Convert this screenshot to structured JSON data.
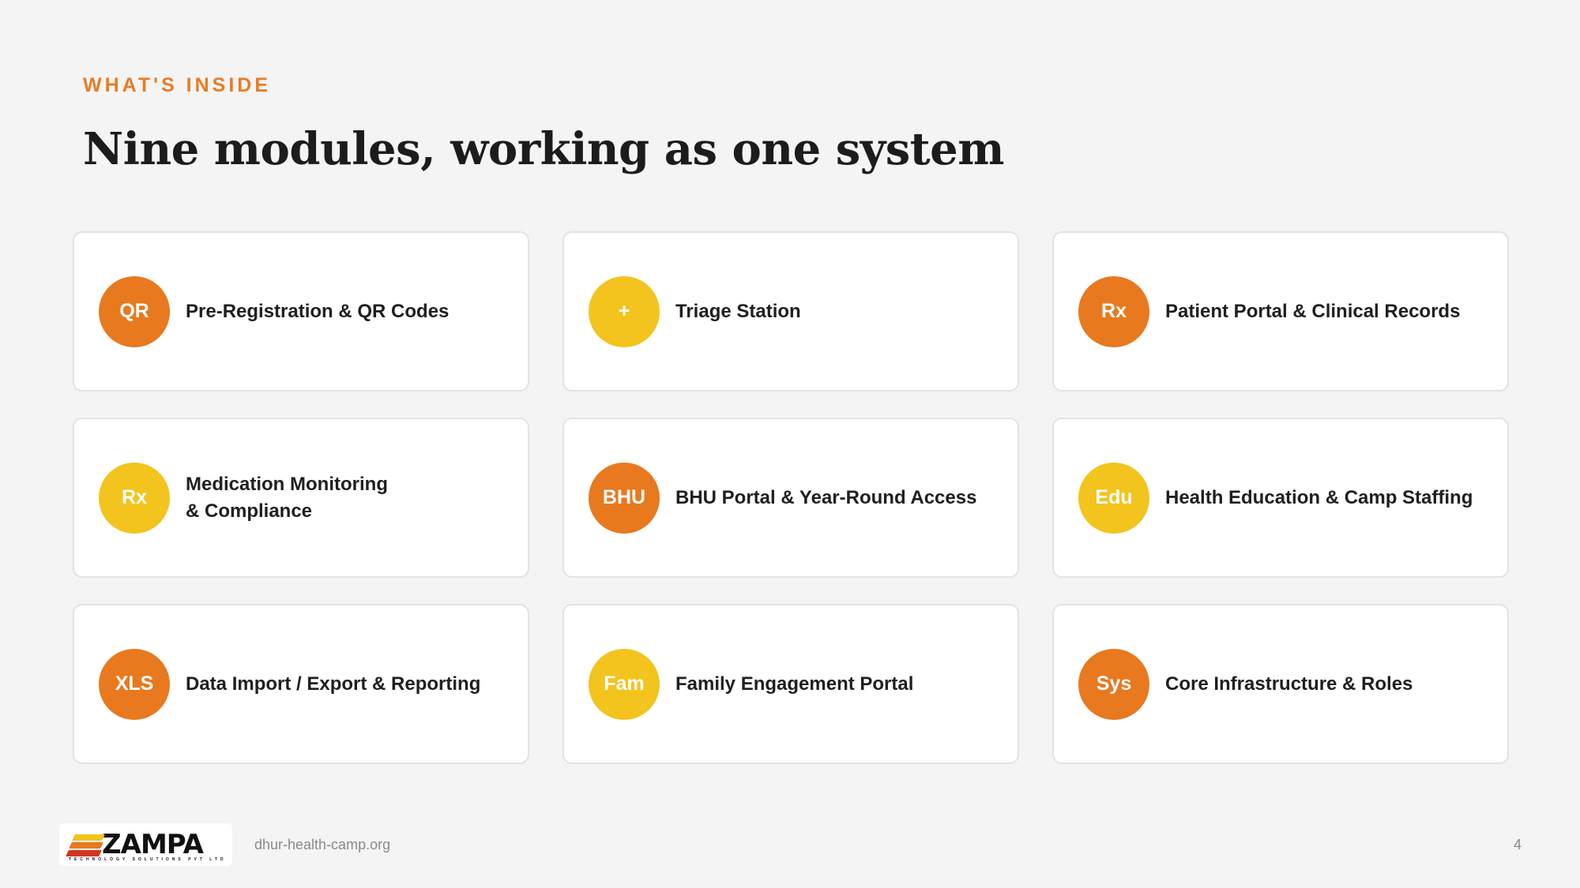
{
  "eyebrow": "WHAT'S INSIDE",
  "title": "Nine modules, working as one system",
  "modules": [
    {
      "badge": "QR",
      "label": "Pre-Registration & QR Codes",
      "color": "#e8791f"
    },
    {
      "badge": "+",
      "label": "Triage Station",
      "color": "#f3c41e"
    },
    {
      "badge": "Rx",
      "label": "Patient Portal & Clinical Records",
      "color": "#e8791f"
    },
    {
      "badge": "Rx",
      "label": "Medication Monitoring & Compliance",
      "color": "#f3c41e"
    },
    {
      "badge": "BHU",
      "label": "BHU Portal & Year-Round Access",
      "color": "#e8791f"
    },
    {
      "badge": "Edu",
      "label": "Health Education & Camp Staffing",
      "color": "#f3c41e"
    },
    {
      "badge": "XLS",
      "label": "Data Import / Export & Reporting",
      "color": "#e8791f"
    },
    {
      "badge": "Fam",
      "label": "Family Engagement Portal",
      "color": "#f3c41e"
    },
    {
      "badge": "Sys",
      "label": "Core Infrastructure & Roles",
      "color": "#e8791f"
    }
  ],
  "footer": {
    "logo_text": "ZAMPA",
    "logo_subtext": "TECHNOLOGY SOLUTIONS PVT LTD",
    "url": "dhur-health-camp.org",
    "page_number": "4"
  },
  "colors": {
    "accent_orange": "#e8791f",
    "accent_yellow": "#f3c41e",
    "background": "#f4f4f4"
  }
}
